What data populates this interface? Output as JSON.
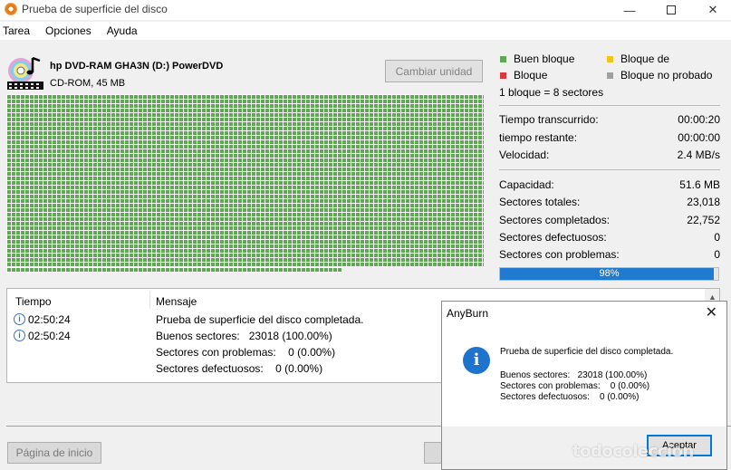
{
  "window": {
    "title": "Prueba de superficie del disco"
  },
  "menu": {
    "items": [
      "Tarea",
      "Opciones",
      "Ayuda"
    ]
  },
  "device": {
    "name": "hp DVD-RAM GHA3N (D:) PowerDVD",
    "info": "CD-ROM, 45 MB",
    "change_button": "Cambiar unidad"
  },
  "legend": {
    "good": "Buen bloque",
    "warn": "Bloque de",
    "bad": "Bloque",
    "untested": "Bloque no probado",
    "note": "1 bloque = 8 sectores",
    "colors": {
      "good": "#5fa955",
      "warn": "#f0c419",
      "bad": "#d9363e",
      "untested": "#a0a0a0"
    }
  },
  "stats": {
    "elapsed_label": "Tiempo transcurrido:",
    "elapsed": "00:00:20",
    "remaining_label": "tiempo restante:",
    "remaining": "00:00:00",
    "speed_label": "Velocidad:",
    "speed": "2.4 MB/s",
    "capacity_label": "Capacidad:",
    "capacity": "51.6 MB",
    "total_label": "Sectores totales:",
    "total": "23,018",
    "done_label": "Sectores completados:",
    "done": "22,752",
    "bad_label": "Sectores defectuosos:",
    "bad": "0",
    "problem_label": "Sectores con problemas:",
    "problem": "0"
  },
  "progress": {
    "value": 0.98,
    "text": "98%"
  },
  "log": {
    "col_time": "Tiempo",
    "col_msg": "Mensaje",
    "rows": [
      {
        "time": "02:50:24",
        "msg": "Prueba de superficie del disco completada."
      },
      {
        "time": "02:50:24",
        "msg": "Buenos sectores:   23018 (100.00%)"
      }
    ],
    "extra": [
      "Sectores con problemas:    0 (0.00%)",
      "Sectores defectuosos:    0 (0.00%)"
    ]
  },
  "footer": {
    "home_button": "Página de inicio"
  },
  "dialog": {
    "title": "AnyBurn",
    "message": "Prueba de superficie del disco completada.",
    "lines": [
      "Buenos sectores:   23018 (100.00%)",
      "Sectores con problemas:    0 (0.00%)",
      "Sectores defectuosos:    0 (0.00%)"
    ],
    "ok": "Aceptar"
  },
  "watermark": "todocoleccion"
}
